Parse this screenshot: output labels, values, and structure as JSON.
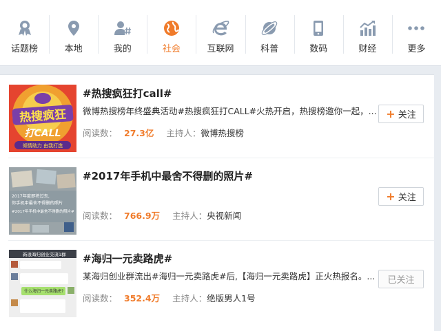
{
  "nav": {
    "items": [
      {
        "label": "话题榜",
        "icon": "medal-icon",
        "active": false
      },
      {
        "label": "本地",
        "icon": "location-pin-icon",
        "active": false
      },
      {
        "label": "我的",
        "icon": "user-hashtag-icon",
        "active": false
      },
      {
        "label": "社会",
        "icon": "globe-icon",
        "active": true
      },
      {
        "label": "互联网",
        "icon": "browser-e-icon",
        "active": false
      },
      {
        "label": "科普",
        "icon": "planet-icon",
        "active": false
      },
      {
        "label": "数码",
        "icon": "phone-icon",
        "active": false
      },
      {
        "label": "财经",
        "icon": "trend-chart-icon",
        "active": false
      },
      {
        "label": "更多",
        "icon": "more-dots-icon",
        "active": false
      }
    ],
    "accent_color": "#f07b2a",
    "icon_color": "#8a9bb0"
  },
  "topics": [
    {
      "title": "#热搜疯狂打call#",
      "description": "微博热搜榜年终盛典活动#热搜疯狂打CALL#火热开启，热搜榜邀你一起，...",
      "read_label": "阅读数：",
      "read_count": "27.3亿",
      "host_label": "主持人：",
      "host": "微博热搜榜",
      "button": "关注",
      "followed": false,
      "thumb_text": [
        "热搜疯狂",
        "打CALL",
        "倾情助力 由我打造"
      ]
    },
    {
      "title": "#2017年手机中最舍不得删的照片#",
      "description": "",
      "read_label": "阅读数：",
      "read_count": "766.9万",
      "host_label": "主持人：",
      "host": "央视新闻",
      "button": "关注",
      "followed": false,
      "thumb_text": [
        "2017年度即将过去,",
        "你手机中最舍不得删的照片",
        "#2017年手机中最舍不得删的照片#"
      ]
    },
    {
      "title": "#海归一元卖路虎#",
      "description": "某海归创业群流出#海归一元卖路虎#后,【海归一元卖路虎】正火热报名。...",
      "read_label": "阅读数：",
      "read_count": "352.4万",
      "host_label": "主持人：",
      "host": "绝版男人1号",
      "button": "已关注",
      "followed": true,
      "thumb_text": [
        "新浪海归创业交流1群",
        "什么海归一元卖路虎?"
      ]
    }
  ]
}
